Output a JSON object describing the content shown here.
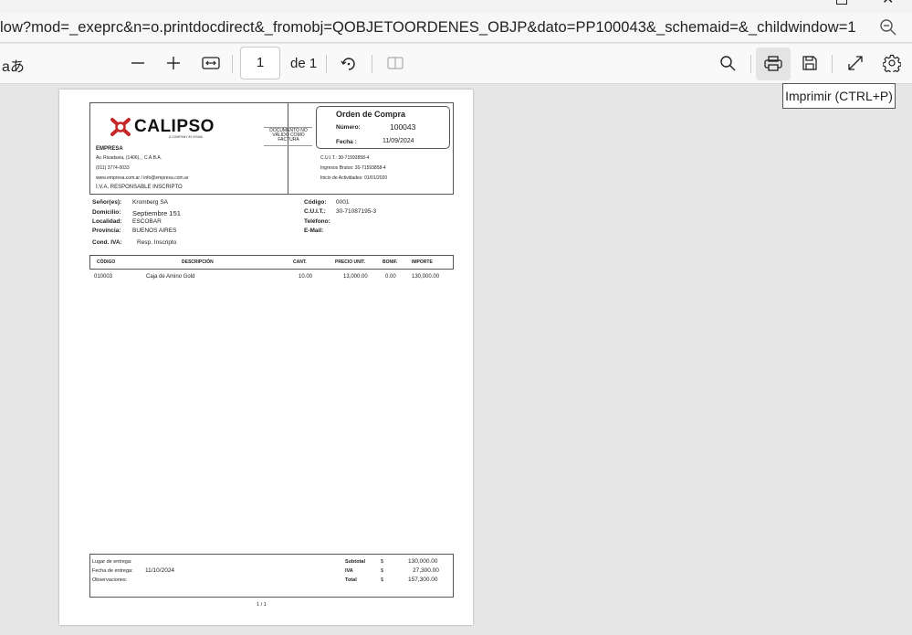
{
  "browser": {
    "url": "low?mod=_exeprc&n=o.printdocdirect&_fromobj=QOBJETOORDENES_OBJP&dato=PP100043&_schemaid=&_childwindow=1"
  },
  "toolbar": {
    "read_aloud": "aあ",
    "page_number": "1",
    "page_total": "de 1",
    "print_tooltip": "Imprimir (CTRL+P)"
  },
  "icons": {
    "zoom_out": "zoom-out-icon",
    "minus": "minus-icon",
    "plus": "plus-icon",
    "fit": "fit-width-icon",
    "rotate": "rotate-icon",
    "two_page": "page-view-icon",
    "search": "search-icon",
    "print": "print-icon",
    "save": "save-icon",
    "fullscreen": "fullscreen-icon",
    "settings": "gear-icon"
  },
  "document": {
    "logo": "CALIPSO",
    "logo_sub": "A COMPANY IN VISMA",
    "not_valid": [
      "DOCUMENTO NO",
      "VÁLIDO COMO",
      "FACTURA"
    ],
    "title": "Orden de Compra",
    "numero_label": "Número:",
    "numero": "100043",
    "fecha_label": "Fecha :",
    "fecha": "11/09/2024",
    "empresa": "EMPRESA",
    "address": "Av. Rivadavia, (1406), , C.A.B.A.",
    "phone": "(011) 3774-0033",
    "web": "www.empresa.com.ar / info@empresa.com.ar",
    "iva_cond": "I.V.A. RESPONSABLE INSCRIPTO",
    "cuit_emp": "C.U.I.T.: 30-71593858-4",
    "ib": "Ingresos Brutos: 30-71593858-4",
    "inicio": "Inicio de Actividades: 01/01/2020",
    "client": {
      "senor_label": "Señor(es):",
      "senor": "Kromberg SA",
      "domicilio_label": "Domicilio:",
      "domicilio": "Septiembre 151",
      "localidad_label": "Localidad:",
      "localidad": "ESCOBAR",
      "provincia_label": "Provincia:",
      "provincia": "BUENOS AIRES",
      "cond_label": "Cond. IVA:",
      "cond": "Resp. Inscripto",
      "codigo_label": "Código:",
      "codigo": "0001",
      "cuit_label": "C.U.I.T.:",
      "cuit": "30-71087195-3",
      "telefono_label": "Teléfono:",
      "email_label": "E-Mail:"
    },
    "columns": [
      "CÓDIGO",
      "DESCRIPCIÓN",
      "CANT.",
      "PRECIO UNIT.",
      "BONIF.",
      "IMPORTE"
    ],
    "rows": [
      [
        "010003",
        "Caja de Amino Gold",
        "10.00",
        "13,000.00",
        "0.00",
        "130,000.00"
      ]
    ],
    "footer": {
      "lugar_label": "Lugar de entrega:",
      "fecha_label": "Fecha de entrega:",
      "fecha": "11/10/2024",
      "obs_label": "Observaciones:",
      "subtotal_label": "Subtotal",
      "subtotal": "130,000.00",
      "iva_label": "IVA",
      "iva": "27,300.00",
      "total_label": "Total",
      "total": "157,300.00",
      "currency": "$"
    },
    "page_of": "1   /   1"
  }
}
